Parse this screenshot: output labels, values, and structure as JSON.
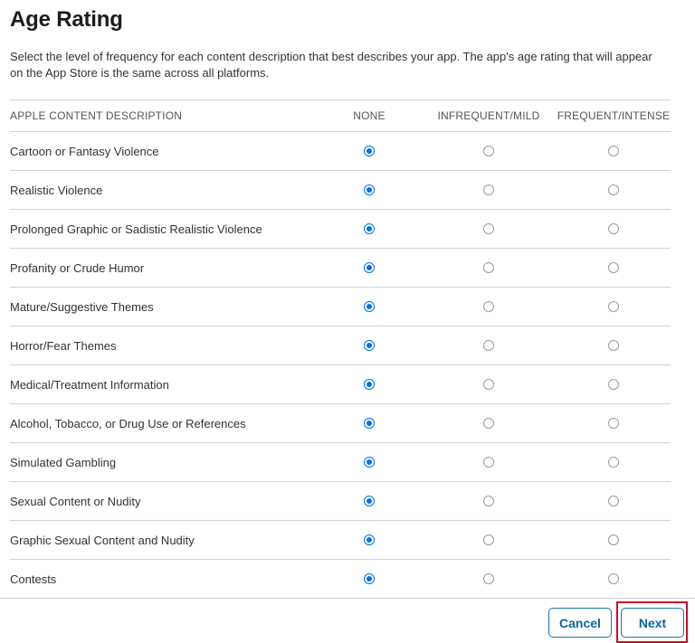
{
  "page": {
    "title": "Age Rating",
    "description": "Select the level of frequency for each content description that best describes your app. The app's age rating that will appear on the App Store is the same across all platforms."
  },
  "table": {
    "headers": {
      "description": "APPLE CONTENT DESCRIPTION",
      "none": "NONE",
      "infrequent": "INFREQUENT/MILD",
      "frequent": "FREQUENT/INTENSE"
    },
    "rows": [
      {
        "label": "Cartoon or Fantasy Violence",
        "selected": "none"
      },
      {
        "label": "Realistic Violence",
        "selected": "none"
      },
      {
        "label": "Prolonged Graphic or Sadistic Realistic Violence",
        "selected": "none"
      },
      {
        "label": "Profanity or Crude Humor",
        "selected": "none"
      },
      {
        "label": "Mature/Suggestive Themes",
        "selected": "none"
      },
      {
        "label": "Horror/Fear Themes",
        "selected": "none"
      },
      {
        "label": "Medical/Treatment Information",
        "selected": "none"
      },
      {
        "label": "Alcohol, Tobacco, or Drug Use or References",
        "selected": "none"
      },
      {
        "label": "Simulated Gambling",
        "selected": "none"
      },
      {
        "label": "Sexual Content or Nudity",
        "selected": "none"
      },
      {
        "label": "Graphic Sexual Content and Nudity",
        "selected": "none"
      },
      {
        "label": "Contests",
        "selected": "none"
      }
    ]
  },
  "footer": {
    "cancel_label": "Cancel",
    "next_label": "Next"
  },
  "colors": {
    "accent": "#0071e3",
    "button_text": "#0a66a0",
    "highlight": "#c8102e",
    "divider": "#d2d2d7"
  }
}
